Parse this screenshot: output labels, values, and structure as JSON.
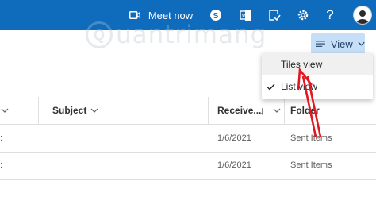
{
  "topbar": {
    "meet_now_label": "Meet now",
    "background": "#0f6cbd",
    "icons": [
      "video-icon",
      "skype-icon",
      "office-icon",
      "todo-icon",
      "gear-icon",
      "help-icon",
      "avatar"
    ]
  },
  "watermark": {
    "text": "uantrimang",
    "circle_letter": "Q"
  },
  "toolbar": {
    "view_label": "View",
    "button_color": "#c7dff6"
  },
  "columns": [
    {
      "label": "Subject"
    },
    {
      "label": "Receive..."
    },
    {
      "label": "Folder"
    }
  ],
  "rows": [
    {
      "from": ":",
      "subject": "",
      "received": "1/6/2021",
      "folder": "Sent Items"
    },
    {
      "from": ":",
      "subject": "",
      "received": "1/6/2021",
      "folder": "Sent Items"
    }
  ],
  "view_menu": {
    "items": [
      {
        "label": "Tiles view",
        "checked": false,
        "highlighted": true
      },
      {
        "label": "List view",
        "checked": true,
        "highlighted": false
      }
    ]
  },
  "annotation": {
    "arrow_color": "#e0181f"
  }
}
